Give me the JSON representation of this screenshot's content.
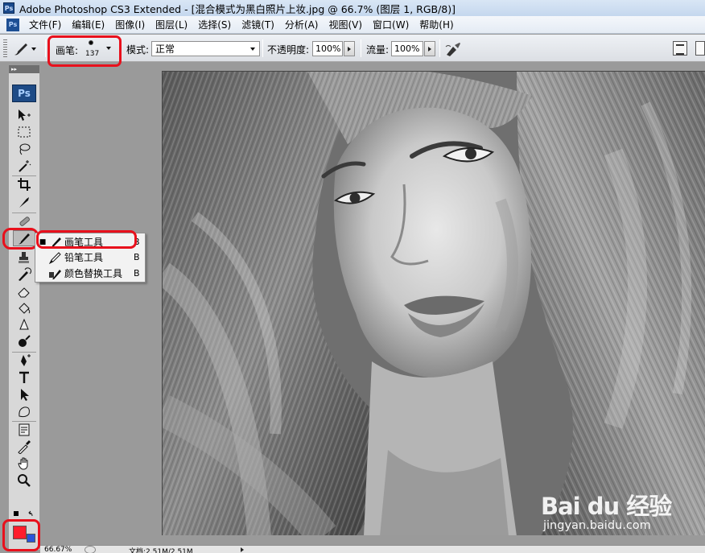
{
  "window": {
    "title": "Adobe Photoshop CS3 Extended - [混合模式为黑白照片上妆.jpg @ 66.7% (图层 1, RGB/8)]",
    "app_icon": "Ps"
  },
  "menubar": {
    "items": [
      "文件(F)",
      "编辑(E)",
      "图像(I)",
      "图层(L)",
      "选择(S)",
      "滤镜(T)",
      "分析(A)",
      "视图(V)",
      "窗口(W)",
      "帮助(H)"
    ]
  },
  "options": {
    "brush_label": "画笔:",
    "brush_size": "137",
    "mode_label": "模式:",
    "mode_value": "正常",
    "opacity_label": "不透明度:",
    "opacity_value": "100%",
    "flow_label": "流量:",
    "flow_value": "100%"
  },
  "toolbox": {
    "logo": "Ps",
    "foreground_color": "#ff1d2c",
    "background_color": "#2a55d8"
  },
  "flyout": {
    "items": [
      {
        "label": "画笔工具",
        "shortcut": "B",
        "selected": true,
        "icon": "brush-icon"
      },
      {
        "label": "铅笔工具",
        "shortcut": "B",
        "selected": false,
        "icon": "pencil-icon"
      },
      {
        "label": "颜色替换工具",
        "shortcut": "B",
        "selected": false,
        "icon": "color-replacement-icon"
      }
    ]
  },
  "statusbar": {
    "zoom": "66.67%",
    "doc_info": "文档:2.51M/2.51M"
  },
  "watermark": {
    "logo": "Bai du 经验",
    "site": "jingyan.baidu.com"
  },
  "colors": {
    "highlight": "#e8101c"
  }
}
